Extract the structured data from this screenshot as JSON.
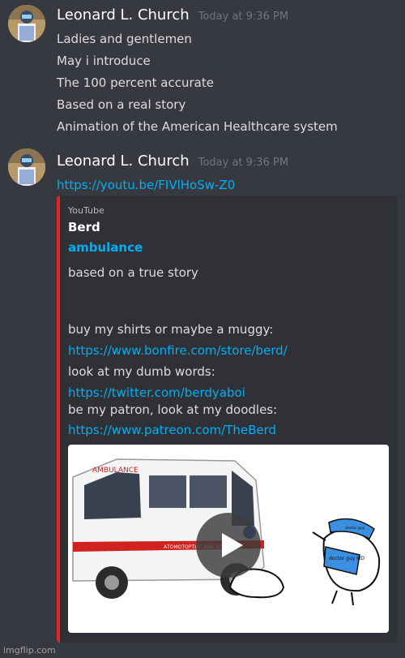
{
  "messages": [
    {
      "author": "Leonard L. Church",
      "timestamp": "Today at 9:36 PM",
      "lines": [
        "Ladies and gentlemen",
        "May i introduce",
        "The 100 percent accurate",
        "Based on a real story",
        "Animation of the American Healthcare system"
      ]
    },
    {
      "author": "Leonard L. Church",
      "timestamp": "Today at 9:36 PM",
      "link": "https://youtu.be/FIVlHoSw-Z0"
    }
  ],
  "embed": {
    "provider": "YouTube",
    "author": "Berd",
    "title": "ambulance",
    "description": [
      {
        "text": "based on a true story",
        "link": false
      },
      {
        "text": "buy my shirts or maybe a muggy:",
        "link": false
      },
      {
        "text": "https://www.bonfire.com/store/berd/",
        "link": true
      },
      {
        "text": "look at my dumb words:",
        "link": false
      },
      {
        "text": "https://twitter.com/berdyaboi",
        "link": true
      },
      {
        "text": "be my patron, look at my doodles:",
        "link": false
      },
      {
        "text": "https://www.patreon.com/TheBerd",
        "link": true
      }
    ],
    "thumbnail": {
      "vehicle_text": "AMBULANCE",
      "vehicle_side_text": "АТОМОТОРТИЛ ВИЙ ЛЛОЖИЛО",
      "badge_text": "doctor guy MD",
      "cap_text": "doctor guy"
    }
  },
  "watermark": "imgflip.com",
  "colors": {
    "background": "#36393f",
    "embed_background": "#2f3136",
    "embed_accent": "#e8202a",
    "link": "#00aff4"
  }
}
